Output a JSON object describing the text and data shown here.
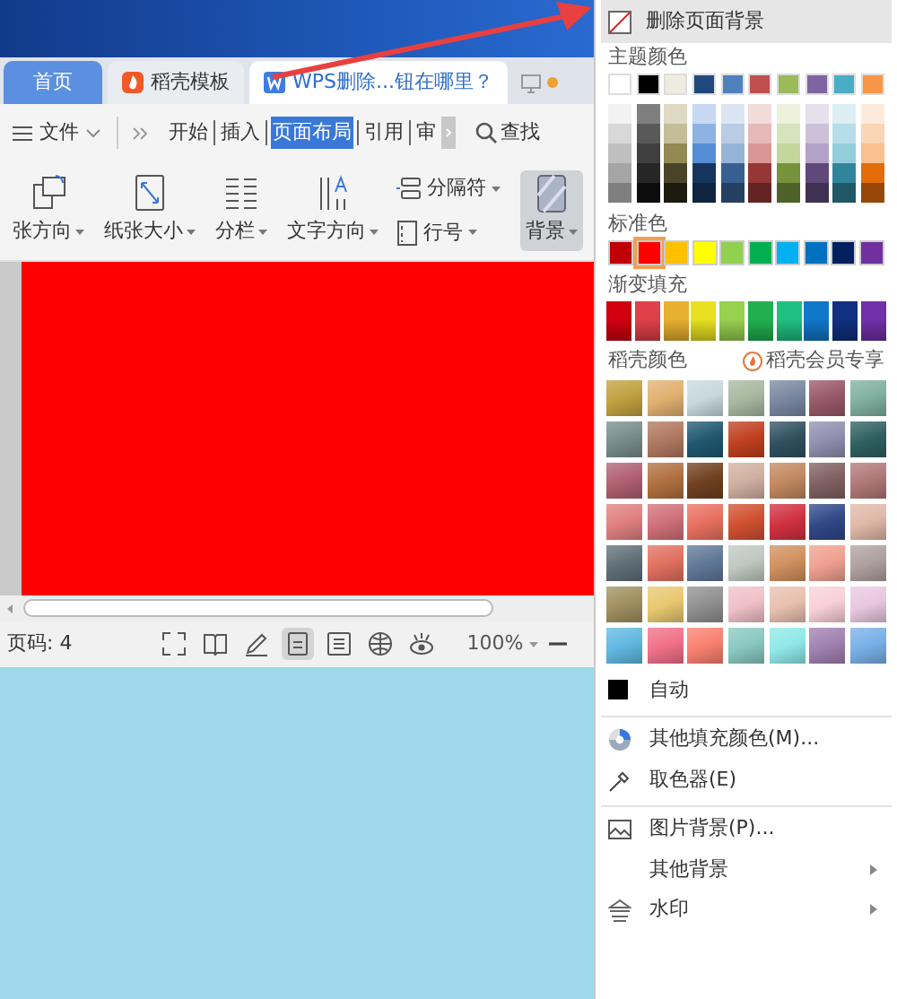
{
  "tabs": [
    {
      "label": "首页",
      "kind": "home",
      "selected": false
    },
    {
      "label": "稻壳模板",
      "kind": "template",
      "selected": false
    },
    {
      "label": "WPS删除...钮在哪里？",
      "kind": "doc",
      "selected": true
    }
  ],
  "menu_bar": {
    "file": "文件",
    "search": "查找",
    "items": [
      {
        "label": "开始",
        "selected": false
      },
      {
        "label": "插入",
        "selected": false
      },
      {
        "label": "页面布局",
        "selected": true
      },
      {
        "label": "引用",
        "selected": false
      },
      {
        "label": "审",
        "selected": false
      }
    ]
  },
  "ribbon": [
    {
      "label": "张方向",
      "pressed": false
    },
    {
      "label": "纸张大小",
      "pressed": false
    },
    {
      "label": "分栏",
      "pressed": false
    },
    {
      "label": "文字方向",
      "pressed": false
    },
    {
      "label": "分隔符",
      "pressed": false
    },
    {
      "label": "行号",
      "pressed": false
    },
    {
      "label": "背景",
      "pressed": true
    }
  ],
  "status_bar": {
    "page": "页码: 4",
    "zoom": "100%",
    "views": [
      {
        "selected": false
      },
      {
        "selected": false
      },
      {
        "selected": false
      },
      {
        "selected": true
      },
      {
        "selected": false
      },
      {
        "selected": false
      },
      {
        "selected": false
      }
    ]
  },
  "dropdown": {
    "remove": {
      "label": "删除页面背景",
      "highlighted": true
    },
    "theme_label": "主题颜色",
    "theme": [
      {
        "color": "#ffffff"
      },
      {
        "color": "#000000"
      },
      {
        "color": "#eeece1"
      },
      {
        "color": "#1f497d"
      },
      {
        "color": "#4f81bd"
      },
      {
        "color": "#c0504d"
      },
      {
        "color": "#9bbb59"
      },
      {
        "color": "#8064a2"
      },
      {
        "color": "#4bacc6"
      },
      {
        "color": "#f79646"
      }
    ],
    "tints": [
      [
        {
          "color": "#f2f2f2"
        },
        {
          "color": "#7f7f7f"
        },
        {
          "color": "#ddd9c3"
        },
        {
          "color": "#c6d9f0"
        },
        {
          "color": "#dbe5f1"
        },
        {
          "color": "#f2dcdb"
        },
        {
          "color": "#ebf1dd"
        },
        {
          "color": "#e5e0ec"
        },
        {
          "color": "#dbeef3"
        },
        {
          "color": "#fdeada"
        }
      ],
      [
        {
          "color": "#d8d8d8"
        },
        {
          "color": "#595959"
        },
        {
          "color": "#c4bd97"
        },
        {
          "color": "#8db3e2"
        },
        {
          "color": "#b8cce4"
        },
        {
          "color": "#e5b9b7"
        },
        {
          "color": "#d7e3bc"
        },
        {
          "color": "#ccc1d9"
        },
        {
          "color": "#b7dde8"
        },
        {
          "color": "#fbd5b5"
        }
      ],
      [
        {
          "color": "#bfbfbf"
        },
        {
          "color": "#3f3f3f"
        },
        {
          "color": "#938953"
        },
        {
          "color": "#548dd4"
        },
        {
          "color": "#95b3d7"
        },
        {
          "color": "#d99694"
        },
        {
          "color": "#c3d69b"
        },
        {
          "color": "#b2a2c7"
        },
        {
          "color": "#92cddc"
        },
        {
          "color": "#fac08f"
        }
      ],
      [
        {
          "color": "#a5a5a5"
        },
        {
          "color": "#262626"
        },
        {
          "color": "#494429"
        },
        {
          "color": "#17365d"
        },
        {
          "color": "#366092"
        },
        {
          "color": "#953734"
        },
        {
          "color": "#76923c"
        },
        {
          "color": "#5f497a"
        },
        {
          "color": "#31859b"
        },
        {
          "color": "#e36c09"
        }
      ],
      [
        {
          "color": "#7f7f7f"
        },
        {
          "color": "#0c0c0c"
        },
        {
          "color": "#1d1b10"
        },
        {
          "color": "#0f243e"
        },
        {
          "color": "#244061"
        },
        {
          "color": "#632423"
        },
        {
          "color": "#4f6128"
        },
        {
          "color": "#3f3151"
        },
        {
          "color": "#205867"
        },
        {
          "color": "#974806"
        }
      ]
    ],
    "standard_label": "标准色",
    "standard": [
      {
        "color": "#c00000",
        "selected": false
      },
      {
        "color": "#ff0000",
        "selected": true
      },
      {
        "color": "#ffc000",
        "selected": false
      },
      {
        "color": "#ffff00",
        "selected": false
      },
      {
        "color": "#92d050",
        "selected": false
      },
      {
        "color": "#00b050",
        "selected": false
      },
      {
        "color": "#00b0f0",
        "selected": false
      },
      {
        "color": "#0070c0",
        "selected": false
      },
      {
        "color": "#002060",
        "selected": false
      },
      {
        "color": "#7030a0",
        "selected": false
      }
    ],
    "gradient_label": "渐变填充",
    "gradients": [
      {
        "color": "#d00010"
      },
      {
        "color": "#e04048"
      },
      {
        "color": "#e8b030"
      },
      {
        "color": "#e8e020"
      },
      {
        "color": "#98d050"
      },
      {
        "color": "#20b050"
      },
      {
        "color": "#20c080"
      },
      {
        "color": "#1078c8"
      },
      {
        "color": "#103080"
      },
      {
        "color": "#7030a8"
      }
    ],
    "docer_label": "稻壳颜色",
    "docer_vip": "稻壳会员专享",
    "docer": [
      [
        {
          "color": "#c0a040"
        },
        {
          "color": "#e0b070"
        },
        {
          "color": "#c8d8dc"
        },
        {
          "color": "#a8b8a0"
        },
        {
          "color": "#7888a0"
        },
        {
          "color": "#985868"
        },
        {
          "color": "#80b0a0"
        }
      ],
      [
        {
          "color": "#788c8c"
        },
        {
          "color": "#b07860"
        },
        {
          "color": "#205870"
        },
        {
          "color": "#c04020"
        },
        {
          "color": "#305060"
        },
        {
          "color": "#9090b0"
        },
        {
          "color": "#306060"
        }
      ],
      [
        {
          "color": "#b06070"
        },
        {
          "color": "#b07040"
        },
        {
          "color": "#704020"
        },
        {
          "color": "#d0b0a0"
        },
        {
          "color": "#c08860"
        },
        {
          "color": "#806060"
        },
        {
          "color": "#b07878"
        }
      ],
      [
        {
          "color": "#e08080"
        },
        {
          "color": "#d07078"
        },
        {
          "color": "#e87060"
        },
        {
          "color": "#d05030"
        },
        {
          "color": "#d03040"
        },
        {
          "color": "#304888"
        },
        {
          "color": "#e0b8a8"
        }
      ],
      [
        {
          "color": "#607078"
        },
        {
          "color": "#e07060"
        },
        {
          "color": "#607898"
        },
        {
          "color": "#c0c8c0"
        },
        {
          "color": "#d09060"
        },
        {
          "color": "#f0a090"
        },
        {
          "color": "#b0a0a0"
        }
      ],
      [
        {
          "color": "#a09060"
        },
        {
          "color": "#e8c870"
        },
        {
          "color": "#909090"
        },
        {
          "color": "#f0c0c8"
        },
        {
          "color": "#e8c0b0"
        },
        {
          "color": "#f8d0d8"
        },
        {
          "color": "#e8c8e0"
        }
      ],
      [
        {
          "color": "#60b8e0"
        },
        {
          "color": "#f07088"
        },
        {
          "color": "#f88070"
        },
        {
          "color": "#88c8c0"
        },
        {
          "color": "#90e8e8"
        },
        {
          "color": "#a080b0"
        },
        {
          "color": "#78b0e8"
        }
      ]
    ],
    "items": [
      {
        "label": "自动",
        "divider_before": false,
        "submenu": false
      },
      {
        "label": "其他填充颜色(M)...",
        "divider_before": true,
        "submenu": false
      },
      {
        "label": "取色器(E)",
        "divider_before": false,
        "submenu": false
      },
      {
        "label": "图片背景(P)...",
        "divider_before": true,
        "submenu": false
      },
      {
        "label": "其他背景",
        "divider_before": false,
        "submenu": true
      },
      {
        "label": "水印",
        "divider_before": false,
        "submenu": true
      }
    ]
  }
}
